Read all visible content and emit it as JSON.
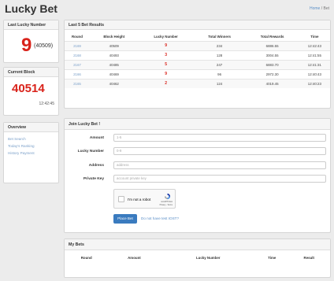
{
  "app": {
    "title": "Lucky Bet"
  },
  "breadcrumb": {
    "home": "Home",
    "separator": "/",
    "current": "Bet"
  },
  "last_lucky": {
    "header": "Last Lucky Number",
    "number": "9",
    "block": "(40509)"
  },
  "current_block": {
    "header": "Current Block",
    "block": "40514",
    "time": "12:42:45"
  },
  "overview": {
    "header": "Overview",
    "links": [
      "Bet Search",
      "Today's Ranking",
      "History Payment"
    ]
  },
  "results": {
    "header": "Last 5 Bet Results",
    "columns": [
      "Round",
      "Block Height",
      "Lucky Number",
      "Total Winners",
      "Total Rewards",
      "Time"
    ],
    "rows": [
      [
        "2169",
        "40509",
        "9",
        "234",
        "6886.55",
        "12:42:43"
      ],
      [
        "2168",
        "40493",
        "3",
        "128",
        "3004.55",
        "12:41:55"
      ],
      [
        "2167",
        "40485",
        "5",
        "247",
        "6883.70",
        "12:41:31"
      ],
      [
        "2166",
        "40469",
        "9",
        "96",
        "2972.30",
        "12:40:43"
      ],
      [
        "2165",
        "40462",
        "2",
        "124",
        "4019.45",
        "12:40:23"
      ]
    ]
  },
  "join": {
    "header": "Join Lucky Bet !",
    "amount_label": "Amount",
    "amount_placeholder": "1-5",
    "lucky_label": "Lucky Number",
    "lucky_placeholder": "0-9",
    "address_label": "Address",
    "address_placeholder": "address",
    "key_label": "Private Key",
    "key_placeholder": "account private key",
    "captcha_text": "I'm not a robot",
    "captcha_brand": "reCAPTCHA",
    "captcha_terms": "Privacy - Terms",
    "submit": "Place Bet",
    "no_iost": "Do not have test IOST?"
  },
  "my_bets": {
    "header": "My Bets",
    "columns": [
      "Round",
      "Amount",
      "Lucky Number",
      "Time",
      "Result"
    ]
  },
  "colors": {
    "accent": "#d9231b",
    "link": "#7ba0c9",
    "button": "#3a7bbf"
  }
}
